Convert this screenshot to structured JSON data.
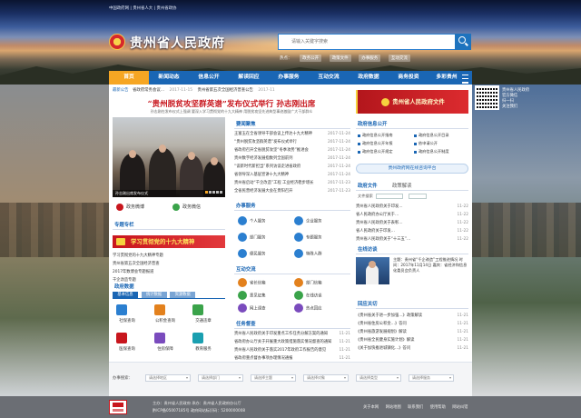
{
  "header": {
    "top_links": "中国政府网 | 贵州省人大 | 贵州省政协",
    "title": "贵州省人民政府",
    "search_placeholder": "请输入关键字搜索",
    "hot_label": "热点：",
    "hot_tags": [
      "政务公开",
      "政策文件",
      "办事服务",
      "互动交流"
    ]
  },
  "nav": {
    "items": [
      "首页",
      "新闻动态",
      "信息公开",
      "解读回应",
      "办事服务",
      "互动交流",
      "政府数据",
      "商务投资",
      "多彩贵州"
    ]
  },
  "qr": {
    "text": [
      "贵州省人民政府",
      "官方微信",
      "扫一扫",
      "关注我们"
    ]
  },
  "ticker": {
    "label": "最新公告",
    "items": [
      {
        "text": "省政府常务会议…",
        "date": "2017-11-15"
      },
      {
        "text": "贵州省第五次全国经济普查公告",
        "date": "2017-11"
      }
    ]
  },
  "headline": {
    "title": "“贵州脱贫攻坚群英谱”发布仪式举行 孙志刚出席",
    "subtitle": "孙志刚在发布仪式上强调 要深入学习贯彻党的十九大精神 用脱贫攻坚先进典型事迹激励广大干部群众"
  },
  "photo": {
    "caption": "孙志刚出席发布仪式"
  },
  "quick": [
    "政务微博",
    "政务微信"
  ],
  "focus": {
    "title": "要闻聚焦",
    "items": [
      {
        "text": "王富玉在全省领导干部会议上传达十九大精神",
        "date": "2017-11-24"
      },
      {
        "text": "“贵州脱贫攻坚群英谱”发布仪式举行",
        "date": "2017-11-24"
      },
      {
        "text": "省政府召开全省脱贫攻坚“冬季攻势”推进会",
        "date": "2017-11-24"
      },
      {
        "text": "贵州数字经济发展指数列全国前列",
        "date": "2017-11-24"
      },
      {
        "text": "“谈新时代新担当”系列访谈走进省政府",
        "date": "2017-11-24"
      },
      {
        "text": "省领导深入基层宣讲十九大精神",
        "date": "2017-11-24"
      },
      {
        "text": "贵州省启动“千企改造”工程 工业经济稳步增长",
        "date": "2017-11-23"
      },
      {
        "text": "全省民营经济发展大会在贵阳召开",
        "date": "2017-11-23"
      }
    ]
  },
  "strip": {
    "text": "学习贯彻党的十九大精神"
  },
  "special": {
    "title": "专题专栏",
    "items": [
      {
        "text": "学习贯彻党的十九大精神专题"
      },
      {
        "text": "贵州省第五次全国经济普查"
      },
      {
        "text": "2017年数博会专题报道"
      },
      {
        "text": "千企改造专题"
      }
    ]
  },
  "service": {
    "title": "办事服务",
    "items": [
      "个人服务",
      "企业服务",
      "部门服务",
      "专题服务",
      "便民服务",
      "特殊人群"
    ]
  },
  "tabs": {
    "title": "政府数据",
    "items": [
      "基本信息",
      "统计数据",
      "资源数据"
    ],
    "grid": [
      "社保查询",
      "公积金查询",
      "交通违章",
      "医保查询",
      "住房保障",
      "教育服务"
    ]
  },
  "interact": {
    "title": "互动交流",
    "items": [
      "省长信箱",
      "部门信箱",
      "意见征集",
      "在线访谈",
      "网上调查",
      "热点回应"
    ]
  },
  "tasks": {
    "title": "任务督查",
    "items": [
      {
        "text": "贵州省人民政府关于印发重点工作任务分解方案的通知",
        "date": "11-21"
      },
      {
        "text": "省政府办公厅关于开展重大政策措施落实情况督查的通知",
        "date": "11-21"
      },
      {
        "text": "贵州省人民政府关于落实2017年政府工作报告的意见",
        "date": "11-21"
      },
      {
        "text": "省政府重点督办事项办理情况通报",
        "date": "11-21"
      },
      {
        "text": "关于开展第四次大督查情况的通报",
        "date": "11-21"
      }
    ]
  },
  "right": {
    "gov_banner": "贵州省人民政府文件",
    "public_title": "政府信息公开",
    "public_items": [
      "政府信息公开指南",
      "政府信息公开目录",
      "政府信息公开年报",
      "依申请公开",
      "政府信息公开规定",
      "政府信息公开制度"
    ],
    "blue_button": "贵州政府网在线咨询平台",
    "doc_title": "政府文件",
    "doc_tab2": "政策解读",
    "search_label": "文件搜索",
    "docs": [
      {
        "text": "贵州省人民政府关于印发…",
        "date": "11-22"
      },
      {
        "text": "省人民政府办公厅关于…",
        "date": "11-22"
      },
      {
        "text": "贵州省人民政府关于表彰…",
        "date": "11-22"
      },
      {
        "text": "省人民政府关于印发…",
        "date": "11-22"
      },
      {
        "text": "贵州省人民政府关于“十三五”…",
        "date": "11-22"
      }
    ],
    "online_title": "在线访谈",
    "online_text": "主题：贵州省“千企改造”工程推进情况 时间：2017年11月14日 嘉宾：省经济和信息化委员会负责人",
    "reply_title": "回应关切",
    "replies": [
      {
        "text": "《贵州省关于进一步加强…》政策解读",
        "date": "11-21"
      },
      {
        "text": "《贵州省住房公积金…》答问",
        "date": "11-21"
      },
      {
        "text": "《贵州省旅游发展规划》解读",
        "date": "11-21"
      },
      {
        "text": "《贵州省全民健身实施计划》解读",
        "date": "11-21"
      },
      {
        "text": "《关于加快推进城镇化…》答问",
        "date": "11-21"
      }
    ]
  },
  "filters": {
    "label": "办事搜索：",
    "selects": [
      "请选择地区",
      "请选择部门",
      "请选择主题",
      "请选择对象",
      "请选择类型",
      "请选择服务"
    ]
  },
  "footer": {
    "line1": "主办：贵州省人民政府 承办：贵州省人民政府办公厅",
    "line2": "黔ICP备05007185号 政府网站标识码：5200000008",
    "links": [
      "关于本网",
      "网站地图",
      "联系我们",
      "使用帮助",
      "网站纠错"
    ]
  }
}
